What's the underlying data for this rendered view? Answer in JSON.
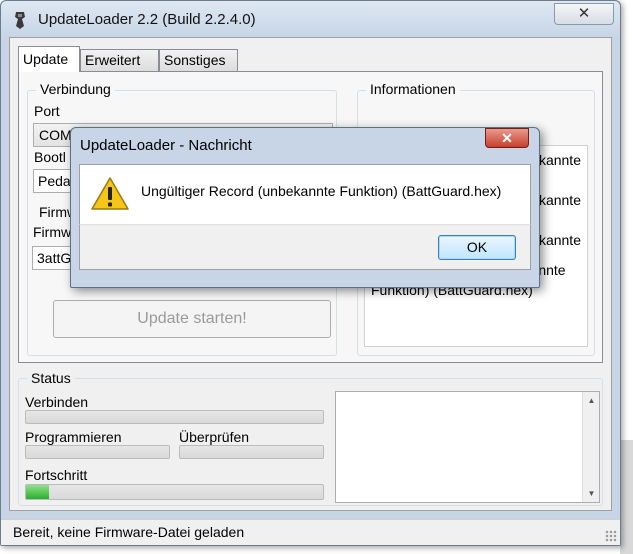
{
  "window": {
    "title": "UpdateLoader 2.2 (Build 2.2.4.0)",
    "close_glyph": "✕"
  },
  "tabs": [
    {
      "label": "Update",
      "active": true
    },
    {
      "label": "Erweitert",
      "active": false
    },
    {
      "label": "Sonstiges",
      "active": false
    }
  ],
  "connection": {
    "legend": "Verbindung",
    "port_label": "Port",
    "port_value": "COM",
    "bootloader_label": "Bootl",
    "bootloader_value": "Peda"
  },
  "firmware": {
    "legend": "Firmw",
    "file_label": "Firmw",
    "file_value": "3attG"
  },
  "update_button": "Update starten!",
  "information": {
    "legend": "Informationen",
    "lines": [
      "kannte",
      "",
      "kannte",
      "",
      "kannte",
      "",
      "Ungültiger Record (unbekannte",
      "Funktion) (BattGuard.hex)"
    ]
  },
  "status": {
    "legend": "Status",
    "connect_label": "Verbinden",
    "program_label": "Programmieren",
    "verify_label": "Überprüfen",
    "progress_label": "Fortschritt",
    "progress_fraction": 0.03
  },
  "statusbar": {
    "text": "Bereit, keine Firmware-Datei geladen"
  },
  "dialog": {
    "title": "UpdateLoader - Nachricht",
    "close_glyph": "✕",
    "message": "Ungültiger Record (unbekannte Funktion) (BattGuard.hex)",
    "ok_label": "OK",
    "icon": "warning-icon"
  },
  "colors": {
    "progress_green": "#29b02a",
    "warning_yellow": "#f5c518",
    "dialog_close_red": "#c8402c"
  }
}
